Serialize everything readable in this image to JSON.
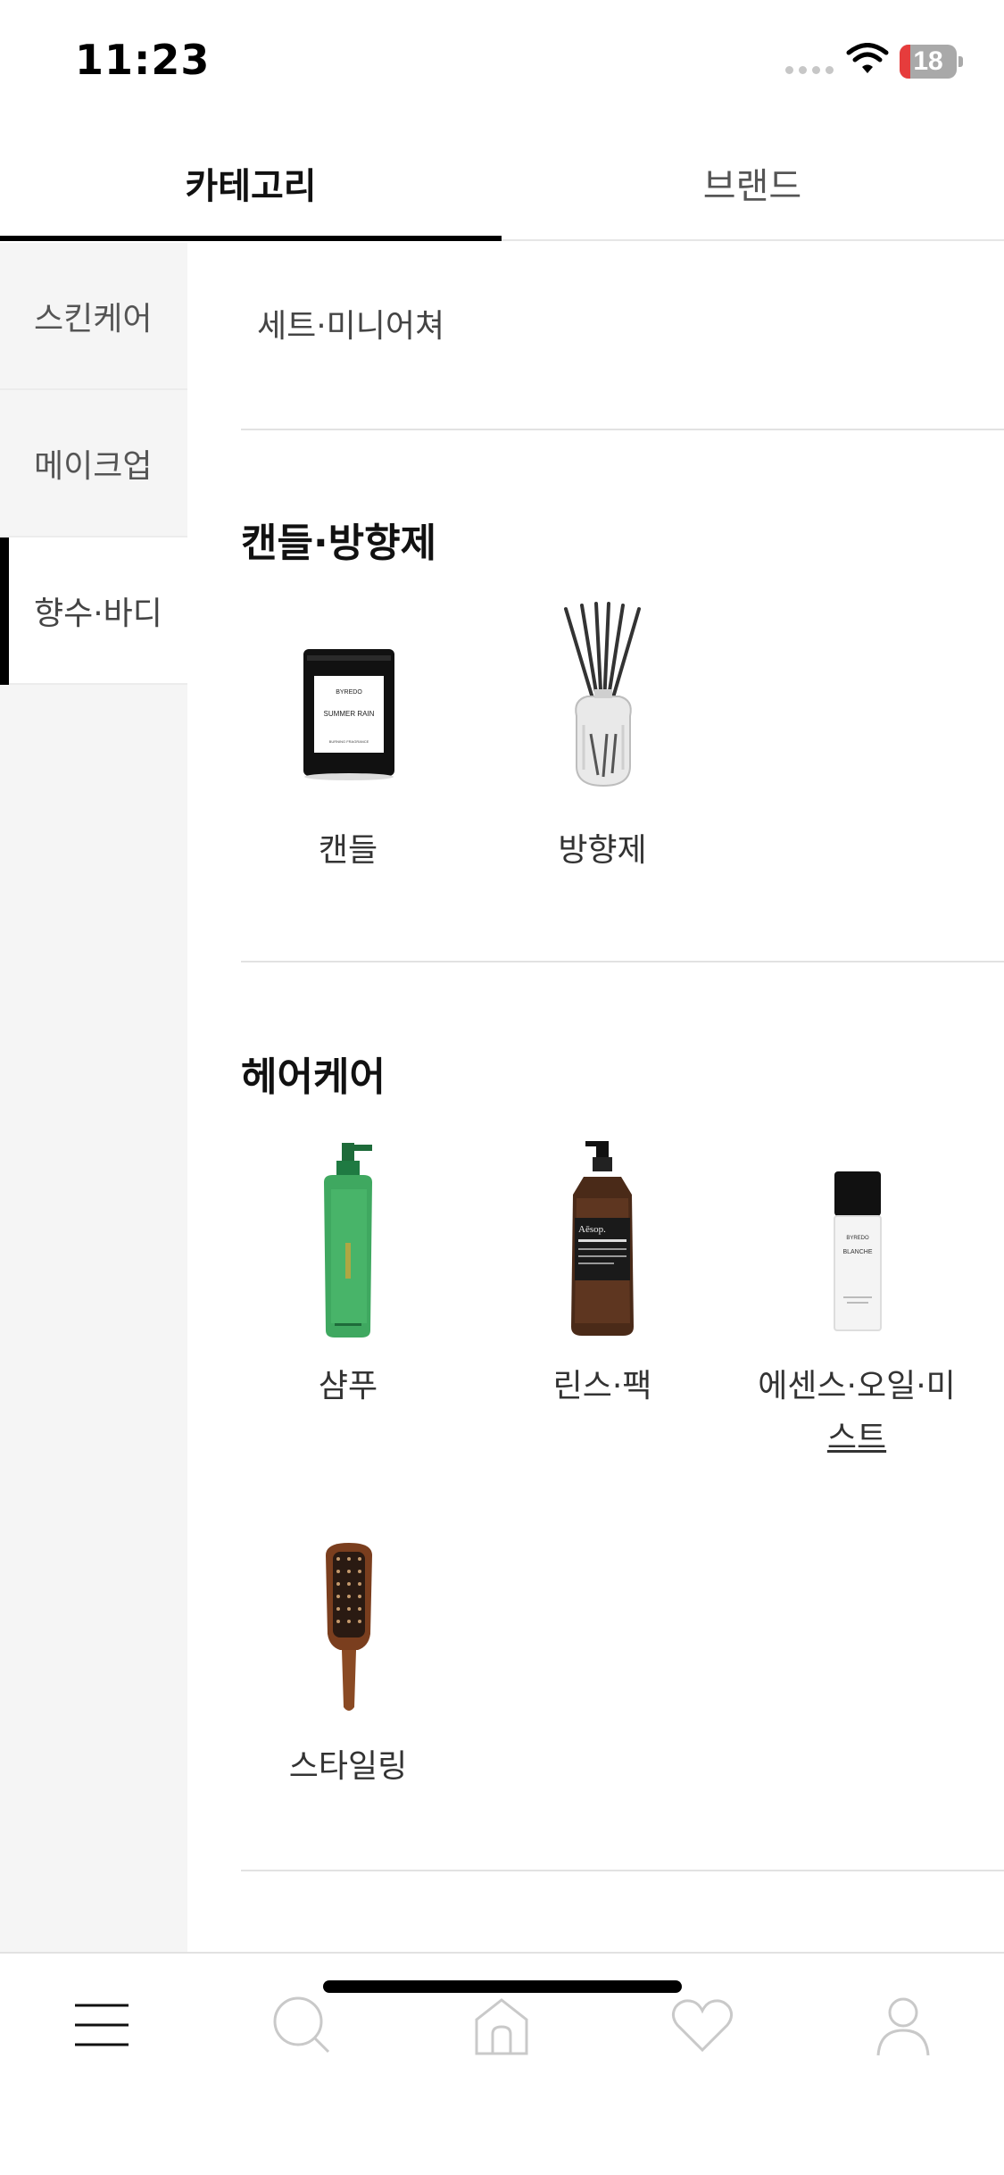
{
  "status_bar": {
    "time": "11:23",
    "battery": "18",
    "battery_level": 0.18
  },
  "top_tabs": [
    {
      "label": "카테고리",
      "active": true
    },
    {
      "label": "브랜드",
      "active": false
    }
  ],
  "sidebar": {
    "items": [
      {
        "label": "스킨케어",
        "active": false
      },
      {
        "label": "메이크업",
        "active": false
      },
      {
        "label": "향수·바디",
        "active": true
      }
    ]
  },
  "main": {
    "set_link": "세트·미니어쳐",
    "sections": [
      {
        "title": "캔들·방향제",
        "items": [
          {
            "label": "캔들",
            "image": "candle",
            "image_text": [
              "BYREDO",
              "SUMMER RAIN",
              "BURNING FRAGRANCE"
            ]
          },
          {
            "label": "방향제",
            "image": "reed-diffuser"
          }
        ]
      },
      {
        "title": "헤어케어",
        "items": [
          {
            "label": "샴푸",
            "image": "green-pump-bottle"
          },
          {
            "label": "린스·팩",
            "image": "amber-pump-bottle",
            "image_text": [
              "Aēsop."
            ]
          },
          {
            "label_line1": "에센스·오일·미",
            "label_line2": "스트",
            "image": "spray-bottle",
            "image_text": [
              "BYREDO",
              "BLANCHE"
            ]
          },
          {
            "label": "스타일링",
            "image": "paddle-brush"
          }
        ]
      }
    ]
  },
  "bottom_nav": [
    {
      "icon": "menu-icon",
      "active": true
    },
    {
      "icon": "search-icon",
      "active": false
    },
    {
      "icon": "home-icon",
      "active": false
    },
    {
      "icon": "heart-icon",
      "active": false
    },
    {
      "icon": "profile-icon",
      "active": false
    }
  ],
  "colors": {
    "active_tab": "#000000",
    "sidebar_bg": "#f5f5f5",
    "battery_low": "#e63c3c",
    "inactive_icon": "#c9c9c9"
  }
}
